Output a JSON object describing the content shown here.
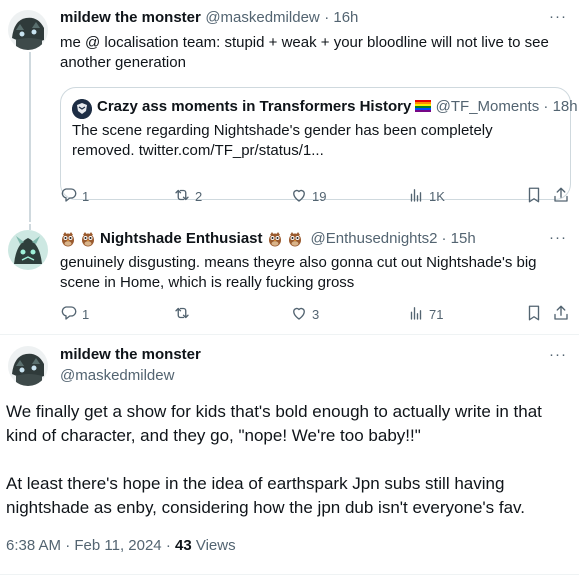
{
  "tweet1": {
    "name": "mildew the monster",
    "handle": "@maskedmildew",
    "time": "· 16h",
    "text": "me @ localisation team: stupid + weak + your bloodline will not live to see another generation",
    "quote": {
      "name": "Crazy ass moments in Transformers History",
      "handle": "@TF_Moments",
      "time": "· 18h",
      "text": "The scene regarding Nightshade's gender has been completely removed. twitter.com/TF_pr/status/1..."
    },
    "actions": {
      "replies": "1",
      "reposts": "2",
      "likes": "19",
      "views": "1K"
    }
  },
  "tweet2": {
    "name": "Nightshade Enthusiast",
    "handle": "@Enthusednights2",
    "time": "· 15h",
    "text": "genuinely disgusting. means theyre also gonna cut out Nightshade's big scene in Home, which is really fucking gross",
    "actions": {
      "replies": "1",
      "reposts": "",
      "likes": "3",
      "views": "71"
    }
  },
  "main": {
    "name": "mildew the monster",
    "handle": "@maskedmildew",
    "para1": "We finally get a show for kids that's bold enough to actually write in that kind of character, and they go, \"nope! We're too baby!!\"",
    "para2": "At least there's hope in the idea of earthspark Jpn subs still having nightshade as enby, considering how the jpn dub isn't everyone's fav.",
    "timestamp": "6:38 AM · Feb 11, 2024 ·",
    "views_count": "43",
    "views_label": "Views"
  },
  "more_label": "···",
  "colors": {
    "accent": "#1d9bf0",
    "muted": "#536471",
    "border": "#cfd9de"
  },
  "icons": [
    "reply-icon",
    "repost-icon",
    "like-icon",
    "views-icon",
    "bookmark-icon",
    "share-icon",
    "more-icon",
    "rainbow-flag-icon",
    "owl-icon"
  ]
}
